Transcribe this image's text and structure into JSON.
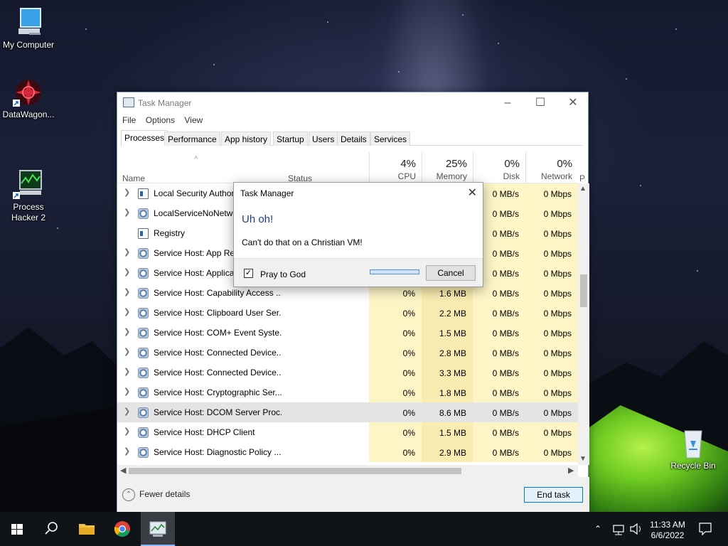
{
  "desktop": {
    "icons": [
      {
        "label": "My Computer"
      },
      {
        "label": "DataWagon..."
      },
      {
        "label": "Process\nHacker 2"
      },
      {
        "label": "Recycle Bin"
      }
    ]
  },
  "task_manager": {
    "title": "Task Manager",
    "menu": [
      "File",
      "Options",
      "View"
    ],
    "tabs": [
      "Processes",
      "Performance",
      "App history",
      "Startup",
      "Users",
      "Details",
      "Services"
    ],
    "active_tab": "Processes",
    "columns": {
      "name": "Name",
      "status": "Status",
      "cpu": {
        "pct": "4%",
        "label": "CPU"
      },
      "memory": {
        "pct": "25%",
        "label": "Memory"
      },
      "disk": {
        "pct": "0%",
        "label": "Disk"
      },
      "network": {
        "pct": "0%",
        "label": "Network"
      },
      "extra": "P"
    },
    "rows": [
      {
        "name": "Local Security Authority...",
        "cpu": "",
        "mem": "",
        "disk": "0 MB/s",
        "net": "0 Mbps",
        "icon": "win-icon",
        "expand": true
      },
      {
        "name": "LocalServiceNoNetwork",
        "cpu": "",
        "mem": "",
        "disk": "0 MB/s",
        "net": "0 Mbps",
        "icon": "gear-icon",
        "expand": true
      },
      {
        "name": "Registry",
        "cpu": "",
        "mem": "",
        "disk": "0 MB/s",
        "net": "0 Mbps",
        "icon": "win-icon",
        "expand": false
      },
      {
        "name": "Service Host: App Readiness",
        "cpu": "",
        "mem": "",
        "disk": "0 MB/s",
        "net": "0 Mbps",
        "icon": "gear-icon",
        "expand": true
      },
      {
        "name": "Service Host: Application...",
        "cpu": "",
        "mem": "",
        "disk": "0 MB/s",
        "net": "0 Mbps",
        "icon": "gear-icon",
        "expand": true
      },
      {
        "name": "Service Host: Capability Access ...",
        "cpu": "0%",
        "mem": "1.6 MB",
        "disk": "0 MB/s",
        "net": "0 Mbps",
        "icon": "gear-icon",
        "expand": true
      },
      {
        "name": "Service Host: Clipboard User Ser...",
        "cpu": "0%",
        "mem": "2.2 MB",
        "disk": "0 MB/s",
        "net": "0 Mbps",
        "icon": "gear-icon",
        "expand": true
      },
      {
        "name": "Service Host: COM+ Event Syste...",
        "cpu": "0%",
        "mem": "1.5 MB",
        "disk": "0 MB/s",
        "net": "0 Mbps",
        "icon": "gear-icon",
        "expand": true
      },
      {
        "name": "Service Host: Connected Device...",
        "cpu": "0%",
        "mem": "2.8 MB",
        "disk": "0 MB/s",
        "net": "0 Mbps",
        "icon": "gear-icon",
        "expand": true
      },
      {
        "name": "Service Host: Connected Device...",
        "cpu": "0%",
        "mem": "3.3 MB",
        "disk": "0 MB/s",
        "net": "0 Mbps",
        "icon": "gear-icon",
        "expand": true
      },
      {
        "name": "Service Host: Cryptographic Ser...",
        "cpu": "0%",
        "mem": "1.8 MB",
        "disk": "0 MB/s",
        "net": "0 Mbps",
        "icon": "gear-icon",
        "expand": true
      },
      {
        "name": "Service Host: DCOM Server Proc...",
        "cpu": "0%",
        "mem": "8.6 MB",
        "disk": "0 MB/s",
        "net": "0 Mbps",
        "icon": "gear-icon",
        "expand": true,
        "selected": true
      },
      {
        "name": "Service Host: DHCP Client",
        "cpu": "0%",
        "mem": "1.5 MB",
        "disk": "0 MB/s",
        "net": "0 Mbps",
        "icon": "gear-icon",
        "expand": true
      },
      {
        "name": "Service Host: Diagnostic Policy ...",
        "cpu": "0%",
        "mem": "2.9 MB",
        "disk": "0 MB/s",
        "net": "0 Mbps",
        "icon": "gear-icon",
        "expand": true
      }
    ],
    "fewer_details": "Fewer details",
    "end_task": "End task"
  },
  "dialog": {
    "title": "Task Manager",
    "heading": "Uh oh!",
    "message": "Can't do that on a Christian VM!",
    "checkbox_label": "Pray to God",
    "checkbox_checked": true,
    "cancel": "Cancel"
  },
  "taskbar": {
    "time": "11:33 AM",
    "date": "6/6/2022",
    "pinned": [
      "start-icon",
      "search-icon",
      "file-explorer-icon",
      "chrome-icon",
      "task-manager-icon"
    ]
  }
}
